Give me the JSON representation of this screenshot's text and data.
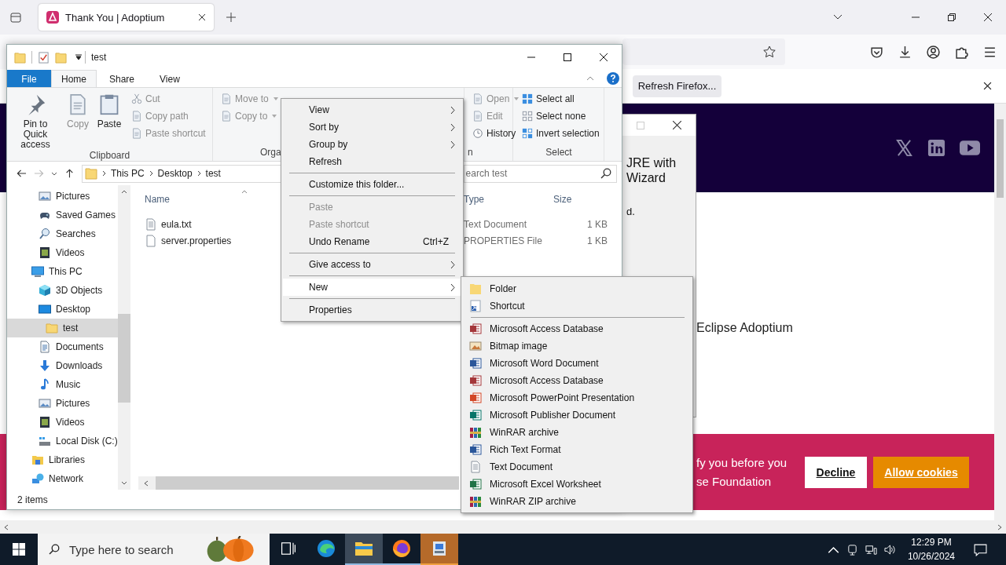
{
  "browser": {
    "tabs": [
      {
        "title": "Thank You | Adoptium",
        "selected": true
      }
    ],
    "notification": {
      "button": "Refresh Firefox..."
    },
    "installer_dialog": {
      "heading_lines": [
        "JRE with",
        "Wizard"
      ],
      "body": "d."
    },
    "page_text": "Eclipse Adoptium",
    "cookie_banner": {
      "lines": [
        "fy you before you",
        "se Foundation"
      ],
      "buttons": [
        {
          "label": "Decline",
          "kind": "decline"
        },
        {
          "label": "Allow cookies",
          "kind": "accept"
        }
      ]
    }
  },
  "explorer": {
    "title": "test",
    "ribbon_tabs": [
      {
        "label": "File",
        "kind": "file",
        "selected": false
      },
      {
        "label": "Home",
        "kind": "tab",
        "selected": true
      },
      {
        "label": "Share",
        "kind": "tab",
        "selected": false
      },
      {
        "label": "View",
        "kind": "tab",
        "selected": false
      }
    ],
    "ribbon_groups": [
      {
        "label": "Clipboard",
        "large": [
          {
            "label": "Pin to Quick access",
            "kind": "pin",
            "disabled": false
          },
          {
            "label": "Copy",
            "kind": "copy",
            "disabled": true
          },
          {
            "label": "Paste",
            "kind": "paste",
            "disabled": false
          }
        ],
        "small": [
          {
            "label": "Cut",
            "kind": "cut",
            "disabled": true,
            "dropdown": false
          },
          {
            "label": "Copy path",
            "kind": "path",
            "disabled": true,
            "dropdown": false
          },
          {
            "label": "Paste shortcut",
            "kind": "shortcut",
            "disabled": true,
            "dropdown": false
          }
        ]
      },
      {
        "label": "Orga",
        "small": [
          {
            "label": "Move to",
            "kind": "move",
            "disabled": true,
            "dropdown": true
          },
          {
            "label": "Copy to",
            "kind": "copyto",
            "disabled": true,
            "dropdown": true
          }
        ]
      },
      {
        "label": "n",
        "small": [
          {
            "label": "Open",
            "kind": "open",
            "disabled": true,
            "dropdown": true
          },
          {
            "label": "Edit",
            "kind": "edit",
            "disabled": true,
            "dropdown": false
          },
          {
            "label": "History",
            "kind": "history",
            "disabled": false,
            "dropdown": false
          }
        ]
      },
      {
        "label": "Select",
        "small": [
          {
            "label": "Select all",
            "kind": "selall",
            "disabled": false,
            "dropdown": false
          },
          {
            "label": "Select none",
            "kind": "selnone",
            "disabled": false,
            "dropdown": false
          },
          {
            "label": "Invert selection",
            "kind": "invert",
            "disabled": false,
            "dropdown": false
          }
        ]
      }
    ],
    "breadcrumb": [
      "This PC",
      "Desktop",
      "test"
    ],
    "search_text": "earch test",
    "nav_continued": [
      {
        "label": "Pictures",
        "kind": "pictures",
        "selected": false
      },
      {
        "label": "Saved Games",
        "kind": "games",
        "selected": false
      },
      {
        "label": "Searches",
        "kind": "searches",
        "selected": false
      },
      {
        "label": "Videos",
        "kind": "videos",
        "selected": false
      }
    ],
    "nav_tree": [
      {
        "label": "This PC",
        "kind": "pc",
        "selected": false,
        "children": [
          {
            "label": "3D Objects",
            "kind": "cube",
            "selected": false
          },
          {
            "label": "Desktop",
            "kind": "desktop",
            "selected": false,
            "children": [
              {
                "label": "test",
                "kind": "folder",
                "selected": true
              }
            ]
          },
          {
            "label": "Documents",
            "kind": "documents",
            "selected": false
          },
          {
            "label": "Downloads",
            "kind": "downloads",
            "selected": false
          },
          {
            "label": "Music",
            "kind": "music",
            "selected": false
          },
          {
            "label": "Pictures",
            "kind": "pictures",
            "selected": false
          },
          {
            "label": "Videos",
            "kind": "videos",
            "selected": false
          },
          {
            "label": "Local Disk (C:)",
            "kind": "disk",
            "selected": false
          }
        ]
      },
      {
        "label": "Libraries",
        "kind": "libraries",
        "selected": false
      },
      {
        "label": "Network",
        "kind": "network",
        "selected": false
      }
    ],
    "columns": {
      "name": "Name",
      "type": "Type",
      "size": "Size"
    },
    "files": [
      {
        "name": "eula.txt",
        "kind": "text",
        "type": "Text Document",
        "size": "1 KB"
      },
      {
        "name": "server.properties",
        "kind": "blank",
        "type": "PROPERTIES File",
        "size": "1 KB"
      }
    ],
    "status": "2 items"
  },
  "context_menu": [
    [
      {
        "label": "View",
        "submenu": true,
        "disabled": false,
        "highlighted": false
      },
      {
        "label": "Sort by",
        "submenu": true,
        "disabled": false,
        "highlighted": false
      },
      {
        "label": "Group by",
        "submenu": true,
        "disabled": false,
        "highlighted": false
      },
      {
        "label": "Refresh",
        "submenu": false,
        "disabled": false,
        "highlighted": false
      }
    ],
    [
      {
        "label": "Customize this folder...",
        "submenu": false,
        "disabled": false,
        "highlighted": false
      }
    ],
    [
      {
        "label": "Paste",
        "submenu": false,
        "disabled": true,
        "highlighted": false
      },
      {
        "label": "Paste shortcut",
        "submenu": false,
        "disabled": true,
        "highlighted": false
      },
      {
        "label": "Undo Rename",
        "shortcut": "Ctrl+Z",
        "submenu": false,
        "disabled": false,
        "highlighted": false
      }
    ],
    [
      {
        "label": "Give access to",
        "submenu": true,
        "disabled": false,
        "highlighted": false
      }
    ],
    [
      {
        "label": "New",
        "submenu": true,
        "disabled": false,
        "highlighted": true
      }
    ],
    [
      {
        "label": "Properties",
        "submenu": false,
        "disabled": false,
        "highlighted": false
      }
    ]
  ],
  "new_submenu": [
    [
      {
        "label": "Folder",
        "kind": "folder"
      },
      {
        "label": "Shortcut",
        "kind": "shortcut"
      }
    ],
    [
      {
        "label": "Microsoft Access Database",
        "kind": "access"
      },
      {
        "label": "Bitmap image",
        "kind": "bitmap"
      },
      {
        "label": "Microsoft Word Document",
        "kind": "word"
      },
      {
        "label": "Microsoft Access Database",
        "kind": "access"
      },
      {
        "label": "Microsoft PowerPoint Presentation",
        "kind": "powerpoint"
      },
      {
        "label": "Microsoft Publisher Document",
        "kind": "publisher"
      },
      {
        "label": "WinRAR archive",
        "kind": "archive"
      },
      {
        "label": "Rich Text Format",
        "kind": "word"
      },
      {
        "label": "Text Document",
        "kind": "text"
      },
      {
        "label": "Microsoft Excel Worksheet",
        "kind": "excel"
      },
      {
        "label": "WinRAR ZIP archive",
        "kind": "archive"
      }
    ]
  ],
  "taskbar": {
    "search_placeholder": "Type here to search",
    "apps": [
      {
        "kind": "taskview",
        "running": false,
        "active": false,
        "attention": false
      },
      {
        "kind": "edge",
        "running": false,
        "active": false,
        "attention": false
      },
      {
        "kind": "explorer",
        "running": true,
        "active": true,
        "attention": false
      },
      {
        "kind": "firefox",
        "running": true,
        "active": false,
        "attention": false
      },
      {
        "kind": "installer",
        "running": true,
        "active": false,
        "attention": true
      }
    ],
    "time": "12:29 PM",
    "date": "10/26/2024"
  }
}
